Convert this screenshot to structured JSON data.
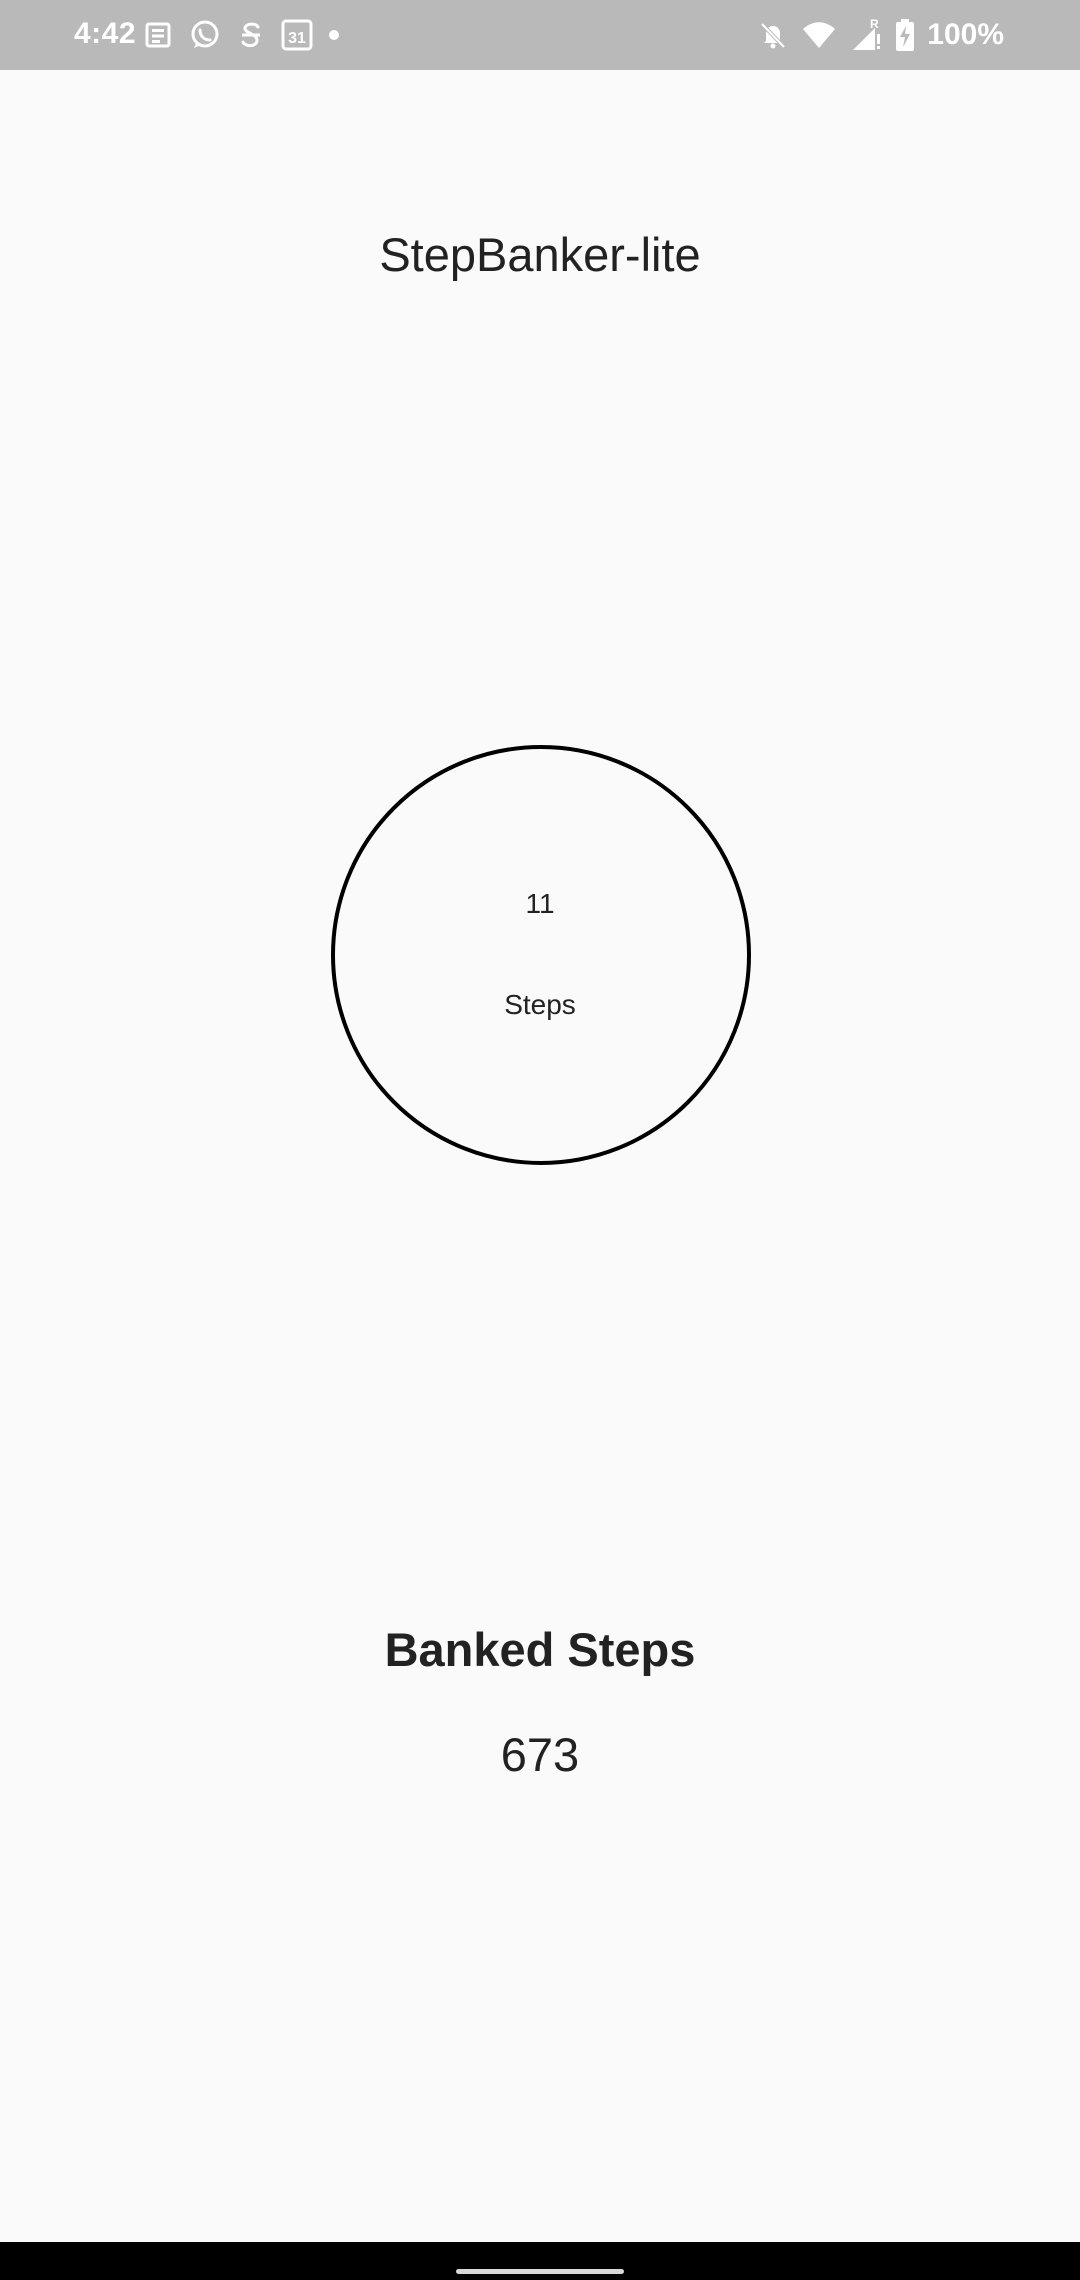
{
  "status_bar": {
    "time": "4:42",
    "battery": "100%",
    "left_icons": [
      "news-icon",
      "whatsapp-icon",
      "s-app-icon",
      "calendar-icon",
      "dot-icon"
    ],
    "calendar_day": "31",
    "right_icons": [
      "bell-off-icon",
      "wifi-icon",
      "signal-icon",
      "battery-charging-icon"
    ],
    "roaming_indicator": "R"
  },
  "app": {
    "title": "StepBanker-lite"
  },
  "current_steps": {
    "count": "11",
    "label": "Steps"
  },
  "banked": {
    "title": "Banked Steps",
    "value": "673"
  },
  "colors": {
    "background": "#fafafa",
    "status_bar": "#b9b9b9",
    "text": "#222222",
    "ring": "#000000",
    "nav_bar": "#000000"
  }
}
